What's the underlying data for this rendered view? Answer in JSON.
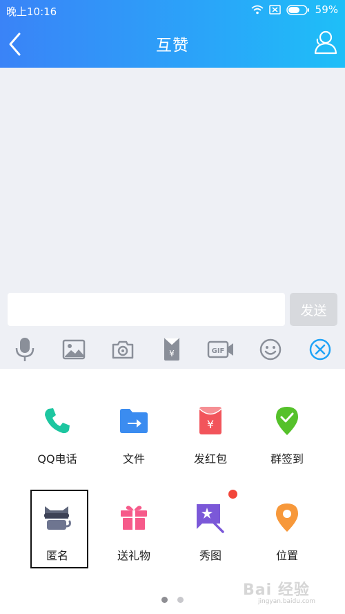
{
  "status_bar": {
    "time": "晚上10:16",
    "battery": "59%"
  },
  "nav": {
    "title": "互赞"
  },
  "composer": {
    "send_label": "发送",
    "input_value": ""
  },
  "toolbar": {
    "icons": [
      "microphone-icon",
      "image-icon",
      "camera-icon",
      "red-packet-icon",
      "gif-icon",
      "emoji-icon",
      "close-circle-icon"
    ],
    "accent": "#1fa3f7"
  },
  "apps": {
    "items": [
      {
        "label": "QQ电话",
        "icon": "phone-icon",
        "color": "#1dc6a0"
      },
      {
        "label": "文件",
        "icon": "folder-icon",
        "color": "#3b8cf0"
      },
      {
        "label": "发红包",
        "icon": "red-packet-icon",
        "color": "#f2545b"
      },
      {
        "label": "群签到",
        "icon": "checkin-pin-icon",
        "color": "#55c12a"
      },
      {
        "label": "匿名",
        "icon": "anonymous-cat-icon",
        "color": "#5d6479"
      },
      {
        "label": "送礼物",
        "icon": "gift-icon",
        "color": "#f65a8a"
      },
      {
        "label": "秀图",
        "icon": "magic-image-icon",
        "color": "#7b58d8"
      },
      {
        "label": "位置",
        "icon": "location-pin-icon",
        "color": "#f7983a"
      }
    ]
  },
  "pager": {
    "pages": 2,
    "current": 1
  },
  "watermark": {
    "text": "Bai 经验",
    "sub": "jingyan.baidu.com"
  }
}
